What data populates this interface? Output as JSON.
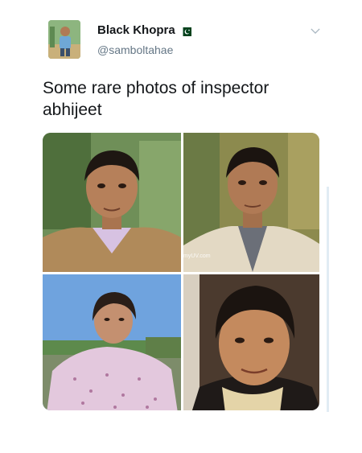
{
  "tweet": {
    "author": {
      "display_name": "Black Khopra",
      "handle": "@samboltahae",
      "flag_icon": "pakistan-flag-icon"
    },
    "menu_icon": "chevron-down-icon",
    "text": "Some rare photos of inspector abhijeet",
    "photos": [
      {
        "name": "photo-1",
        "watermark": ""
      },
      {
        "name": "photo-2",
        "watermark": "myUV.com"
      },
      {
        "name": "photo-3",
        "watermark": ""
      },
      {
        "name": "photo-4",
        "watermark": ""
      }
    ]
  },
  "colors": {
    "text": "#14171a",
    "secondary_text": "#657786",
    "flag_green": "#01411c"
  }
}
